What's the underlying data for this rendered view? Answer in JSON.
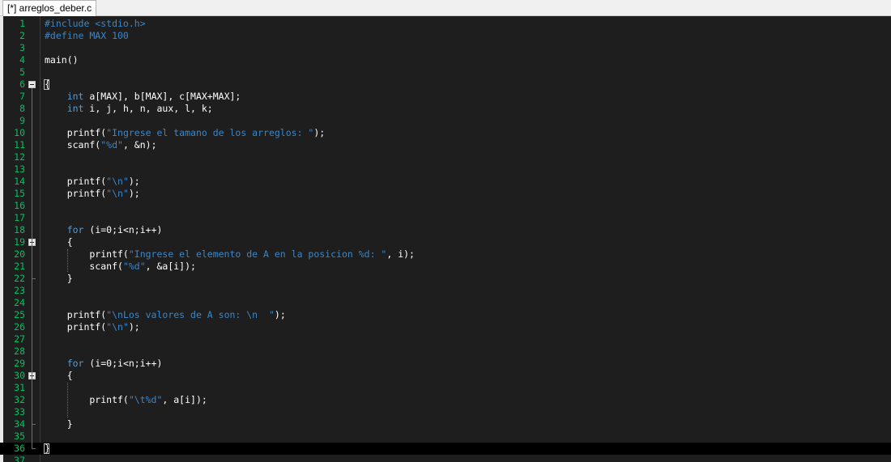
{
  "tab": {
    "label": "[*] arreglos_deber.c"
  },
  "colors": {
    "keyword": "#569cd6",
    "string": "#3a86c8",
    "preprocessor": "#3a86c8",
    "text": "#ffffff",
    "line_number": "#00c060"
  },
  "editor": {
    "current_line": 36,
    "fold_markers": [
      6,
      19,
      30
    ],
    "lines": [
      {
        "n": "1",
        "tokens": [
          {
            "t": "#include <stdio.h>",
            "c": "pp"
          }
        ]
      },
      {
        "n": "2",
        "tokens": [
          {
            "t": "#define MAX 100",
            "c": "pp"
          }
        ]
      },
      {
        "n": "3",
        "tokens": []
      },
      {
        "n": "4",
        "tokens": [
          {
            "t": "main()",
            "c": "x"
          }
        ]
      },
      {
        "n": "5",
        "tokens": []
      },
      {
        "n": "6",
        "tokens": [
          {
            "t": "{",
            "c": "x"
          }
        ]
      },
      {
        "n": "7",
        "tokens": [
          {
            "t": "    ",
            "c": "x"
          },
          {
            "t": "int",
            "c": "kw"
          },
          {
            "t": " a[MAX], b[MAX], c[MAX+MAX];",
            "c": "x"
          }
        ]
      },
      {
        "n": "8",
        "tokens": [
          {
            "t": "    ",
            "c": "x"
          },
          {
            "t": "int",
            "c": "kw"
          },
          {
            "t": " i, j, h, n, aux, l, k;",
            "c": "x"
          }
        ]
      },
      {
        "n": "9",
        "tokens": []
      },
      {
        "n": "10",
        "tokens": [
          {
            "t": "    printf(",
            "c": "x"
          },
          {
            "t": "\"Ingrese el tamano de los arreglos: \"",
            "c": "str"
          },
          {
            "t": ");",
            "c": "x"
          }
        ]
      },
      {
        "n": "11",
        "tokens": [
          {
            "t": "    scanf(",
            "c": "x"
          },
          {
            "t": "\"%d\"",
            "c": "str"
          },
          {
            "t": ", &n);",
            "c": "x"
          }
        ]
      },
      {
        "n": "12",
        "tokens": []
      },
      {
        "n": "13",
        "tokens": []
      },
      {
        "n": "14",
        "tokens": [
          {
            "t": "    printf(",
            "c": "x"
          },
          {
            "t": "\"\\n\"",
            "c": "str"
          },
          {
            "t": ");",
            "c": "x"
          }
        ]
      },
      {
        "n": "15",
        "tokens": [
          {
            "t": "    printf(",
            "c": "x"
          },
          {
            "t": "\"\\n\"",
            "c": "str"
          },
          {
            "t": ");",
            "c": "x"
          }
        ]
      },
      {
        "n": "16",
        "tokens": []
      },
      {
        "n": "17",
        "tokens": []
      },
      {
        "n": "18",
        "tokens": [
          {
            "t": "    ",
            "c": "x"
          },
          {
            "t": "for",
            "c": "kw"
          },
          {
            "t": " (i=0;i<n;i++)",
            "c": "x"
          }
        ]
      },
      {
        "n": "19",
        "tokens": [
          {
            "t": "    {",
            "c": "x"
          }
        ]
      },
      {
        "n": "20",
        "tokens": [
          {
            "t": "        printf(",
            "c": "x"
          },
          {
            "t": "\"Ingrese el elemento de A en la posicion %d: \"",
            "c": "str"
          },
          {
            "t": ", i);",
            "c": "x"
          }
        ]
      },
      {
        "n": "21",
        "tokens": [
          {
            "t": "        scanf(",
            "c": "x"
          },
          {
            "t": "\"%d\"",
            "c": "str"
          },
          {
            "t": ", &a[i]);",
            "c": "x"
          }
        ]
      },
      {
        "n": "22",
        "tokens": [
          {
            "t": "    }",
            "c": "x"
          }
        ]
      },
      {
        "n": "23",
        "tokens": []
      },
      {
        "n": "24",
        "tokens": []
      },
      {
        "n": "25",
        "tokens": [
          {
            "t": "    printf(",
            "c": "x"
          },
          {
            "t": "\"\\nLos valores de A son: \\n  \"",
            "c": "str"
          },
          {
            "t": ");",
            "c": "x"
          }
        ]
      },
      {
        "n": "26",
        "tokens": [
          {
            "t": "    printf(",
            "c": "x"
          },
          {
            "t": "\"\\n\"",
            "c": "str"
          },
          {
            "t": ");",
            "c": "x"
          }
        ]
      },
      {
        "n": "27",
        "tokens": []
      },
      {
        "n": "28",
        "tokens": []
      },
      {
        "n": "29",
        "tokens": [
          {
            "t": "    ",
            "c": "x"
          },
          {
            "t": "for",
            "c": "kw"
          },
          {
            "t": " (i=0;i<n;i++)",
            "c": "x"
          }
        ]
      },
      {
        "n": "30",
        "tokens": [
          {
            "t": "    {",
            "c": "x"
          }
        ]
      },
      {
        "n": "31",
        "tokens": []
      },
      {
        "n": "32",
        "tokens": [
          {
            "t": "        printf(",
            "c": "x"
          },
          {
            "t": "\"\\t%d\"",
            "c": "str"
          },
          {
            "t": ", a[i]);",
            "c": "x"
          }
        ]
      },
      {
        "n": "33",
        "tokens": []
      },
      {
        "n": "34",
        "tokens": [
          {
            "t": "    }",
            "c": "x"
          }
        ]
      },
      {
        "n": "35",
        "tokens": []
      },
      {
        "n": "36",
        "tokens": [
          {
            "t": "}",
            "c": "x"
          }
        ]
      },
      {
        "n": "37",
        "tokens": []
      }
    ]
  }
}
